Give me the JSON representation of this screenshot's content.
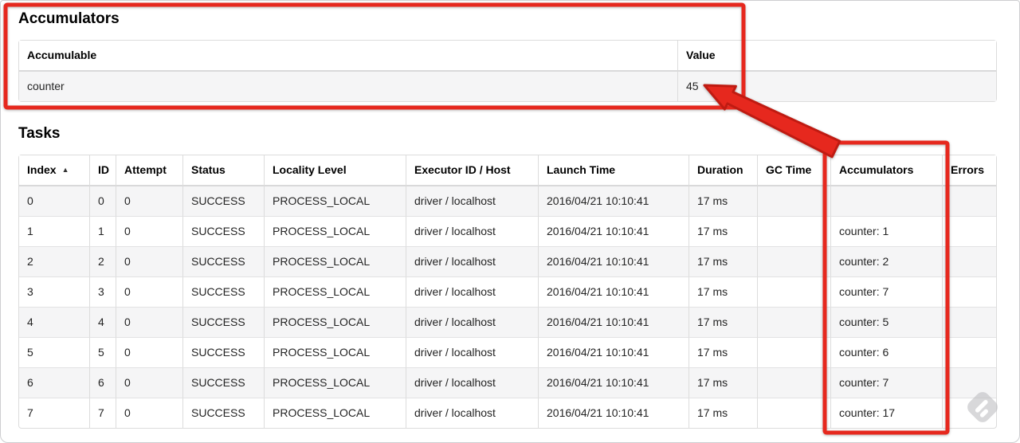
{
  "accumulators_section": {
    "heading": "Accumulators",
    "columns": [
      "Accumulable",
      "Value"
    ],
    "column_keys": [
      "accumulable",
      "value"
    ],
    "rows": [
      {
        "accumulable": "counter",
        "value": "45"
      }
    ]
  },
  "tasks_section": {
    "heading": "Tasks",
    "columns": [
      "Index",
      "ID",
      "Attempt",
      "Status",
      "Locality Level",
      "Executor ID / Host",
      "Launch Time",
      "Duration",
      "GC Time",
      "Accumulators",
      "Errors"
    ],
    "column_keys": [
      "index",
      "id",
      "attempt",
      "status",
      "locality_level",
      "executor_id_host",
      "launch_time",
      "duration",
      "gc_time",
      "accumulators",
      "errors"
    ],
    "sort": {
      "column": "Index",
      "direction": "ascending",
      "icon": "▲"
    },
    "rows": [
      {
        "index": "0",
        "id": "0",
        "attempt": "0",
        "status": "SUCCESS",
        "locality_level": "PROCESS_LOCAL",
        "executor_id_host": "driver / localhost",
        "launch_time": "2016/04/21 10:10:41",
        "duration": "17 ms",
        "gc_time": "",
        "accumulators": "",
        "errors": ""
      },
      {
        "index": "1",
        "id": "1",
        "attempt": "0",
        "status": "SUCCESS",
        "locality_level": "PROCESS_LOCAL",
        "executor_id_host": "driver / localhost",
        "launch_time": "2016/04/21 10:10:41",
        "duration": "17 ms",
        "gc_time": "",
        "accumulators": "counter: 1",
        "errors": ""
      },
      {
        "index": "2",
        "id": "2",
        "attempt": "0",
        "status": "SUCCESS",
        "locality_level": "PROCESS_LOCAL",
        "executor_id_host": "driver / localhost",
        "launch_time": "2016/04/21 10:10:41",
        "duration": "17 ms",
        "gc_time": "",
        "accumulators": "counter: 2",
        "errors": ""
      },
      {
        "index": "3",
        "id": "3",
        "attempt": "0",
        "status": "SUCCESS",
        "locality_level": "PROCESS_LOCAL",
        "executor_id_host": "driver / localhost",
        "launch_time": "2016/04/21 10:10:41",
        "duration": "17 ms",
        "gc_time": "",
        "accumulators": "counter: 7",
        "errors": ""
      },
      {
        "index": "4",
        "id": "4",
        "attempt": "0",
        "status": "SUCCESS",
        "locality_level": "PROCESS_LOCAL",
        "executor_id_host": "driver / localhost",
        "launch_time": "2016/04/21 10:10:41",
        "duration": "17 ms",
        "gc_time": "",
        "accumulators": "counter: 5",
        "errors": ""
      },
      {
        "index": "5",
        "id": "5",
        "attempt": "0",
        "status": "SUCCESS",
        "locality_level": "PROCESS_LOCAL",
        "executor_id_host": "driver / localhost",
        "launch_time": "2016/04/21 10:10:41",
        "duration": "17 ms",
        "gc_time": "",
        "accumulators": "counter: 6",
        "errors": ""
      },
      {
        "index": "6",
        "id": "6",
        "attempt": "0",
        "status": "SUCCESS",
        "locality_level": "PROCESS_LOCAL",
        "executor_id_host": "driver / localhost",
        "launch_time": "2016/04/21 10:10:41",
        "duration": "17 ms",
        "gc_time": "",
        "accumulators": "counter: 7",
        "errors": ""
      },
      {
        "index": "7",
        "id": "7",
        "attempt": "0",
        "status": "SUCCESS",
        "locality_level": "PROCESS_LOCAL",
        "executor_id_host": "driver / localhost",
        "launch_time": "2016/04/21 10:10:41",
        "duration": "17 ms",
        "gc_time": "",
        "accumulators": "counter: 17",
        "errors": ""
      }
    ]
  },
  "annotations": {
    "highlight_color": "#e6281e",
    "highlight_edge_color": "#bf1b12",
    "arrow_points_at": "45",
    "boxed_regions": [
      "accumulators-section",
      "accumulators-column"
    ]
  },
  "watermark": {
    "icon": "diamond-logo-watermark",
    "color": "#b9b9bc"
  }
}
